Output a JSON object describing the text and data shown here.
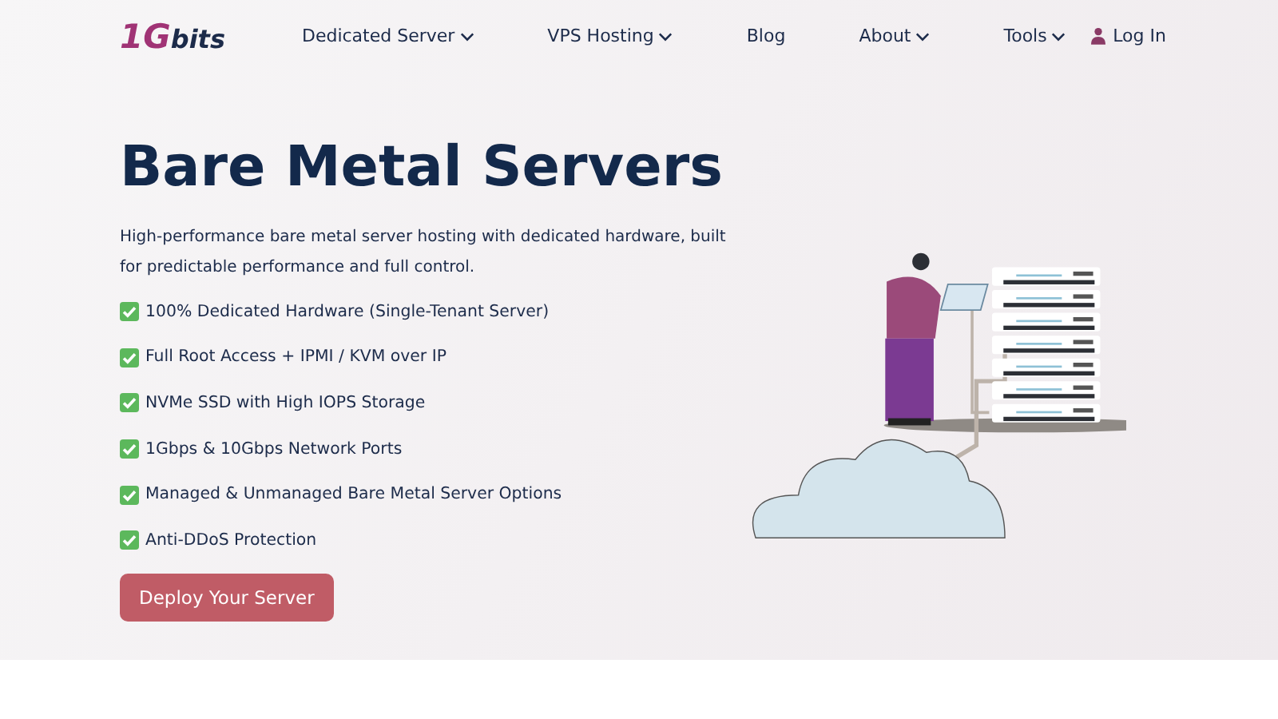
{
  "logo": {
    "mark": "1G",
    "text": "bits"
  },
  "nav": [
    {
      "label": "Dedicated Server",
      "dropdown": true
    },
    {
      "label": "VPS Hosting",
      "dropdown": true
    },
    {
      "label": "Blog",
      "dropdown": false
    },
    {
      "label": "About",
      "dropdown": true
    },
    {
      "label": "Tools",
      "dropdown": true
    }
  ],
  "login": "Log In",
  "hero": {
    "title": "Bare Metal Servers",
    "description": "High-performance bare metal server hosting with dedicated hardware, built for predictable performance and full control.",
    "features": [
      "100% Dedicated Hardware (Single-Tenant Server)",
      "Full Root Access + IPMI / KVM over IP",
      "NVMe SSD with High IOPS Storage",
      "1Gbps & 10Gbps Network Ports",
      "Managed & Unmanaged Bare Metal Server Options",
      "Anti-DDoS Protection"
    ],
    "button": "Deploy Your Server"
  }
}
